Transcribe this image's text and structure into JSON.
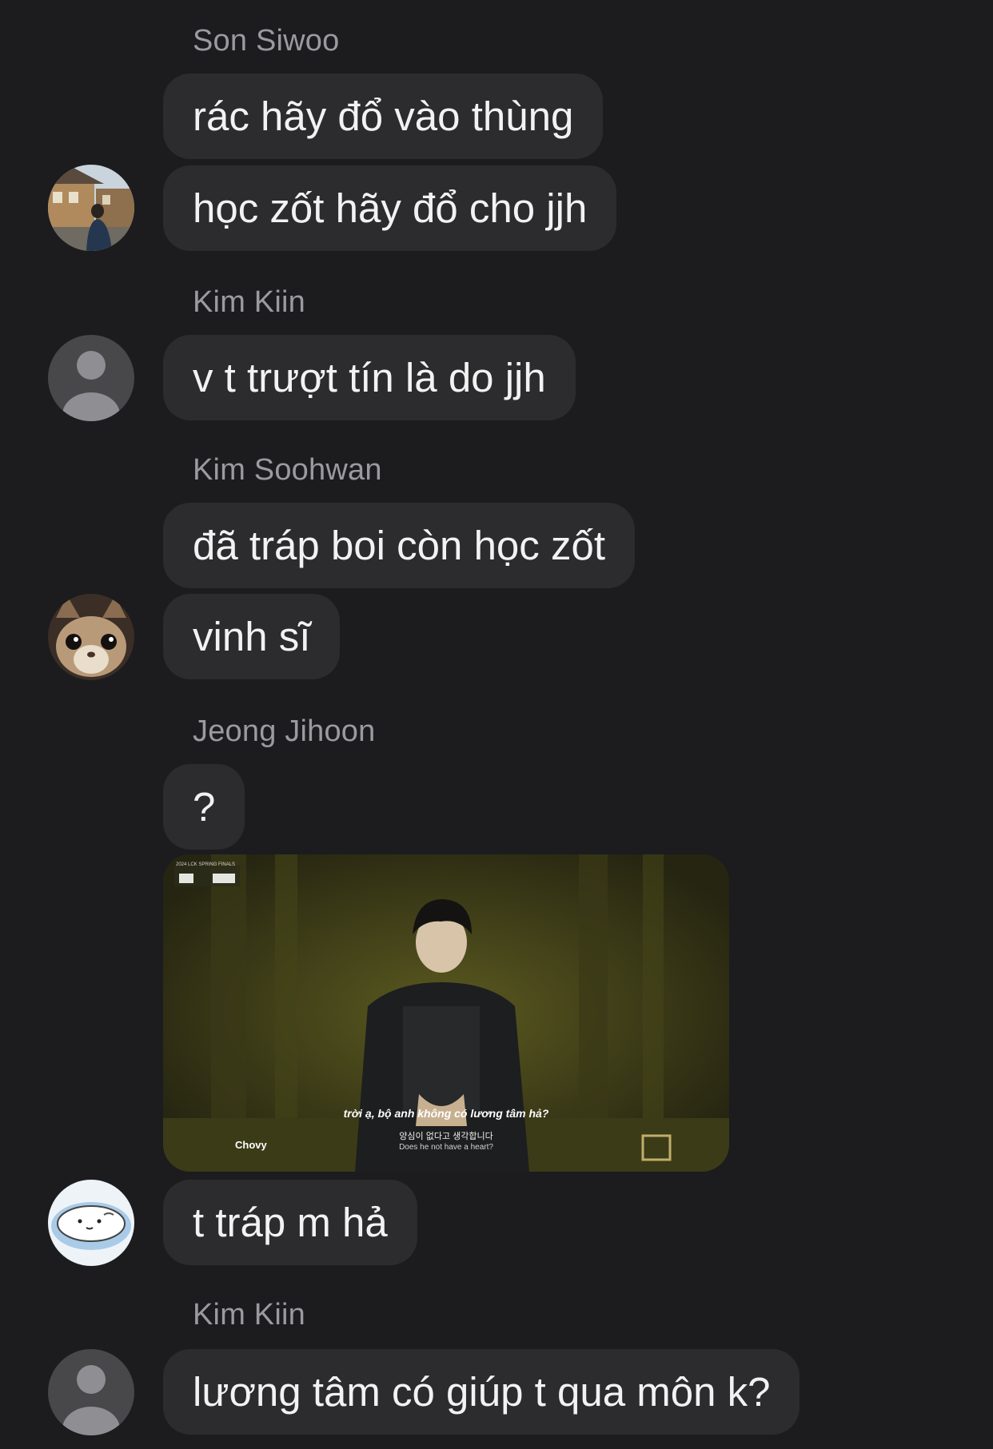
{
  "messages": [
    {
      "sender": "Son Siwoo",
      "texts": [
        "rác hãy đổ vào thùng",
        "học zốt hãy đổ cho jjh"
      ]
    },
    {
      "sender": "Kim Kiin",
      "texts": [
        "v t trượt tín là do jjh"
      ]
    },
    {
      "sender": "Kim Soohwan",
      "texts": [
        "đã tráp boi còn học zốt",
        "vinh sĩ"
      ]
    },
    {
      "sender": "Jeong Jihoon",
      "texts": [
        "?",
        "t tráp m hả"
      ]
    },
    {
      "sender": "Kim Kiin",
      "texts": [
        "lương tâm có giúp t qua môn k?"
      ]
    }
  ],
  "media": {
    "top_left_tag": "2024 LCK SPRING FINALS",
    "player_name": "Chovy",
    "subtitle_vi": "trời ạ, bộ anh không có lương tâm hả?",
    "subtitle_ko": "양심이 없다고 생각합니다",
    "subtitle_en": "Does he not have a heart?"
  },
  "colors": {
    "background": "#1c1c1e",
    "bubble": "#2c2c2e",
    "sender_name": "#9a9aa0",
    "text": "#f2f2f2"
  }
}
